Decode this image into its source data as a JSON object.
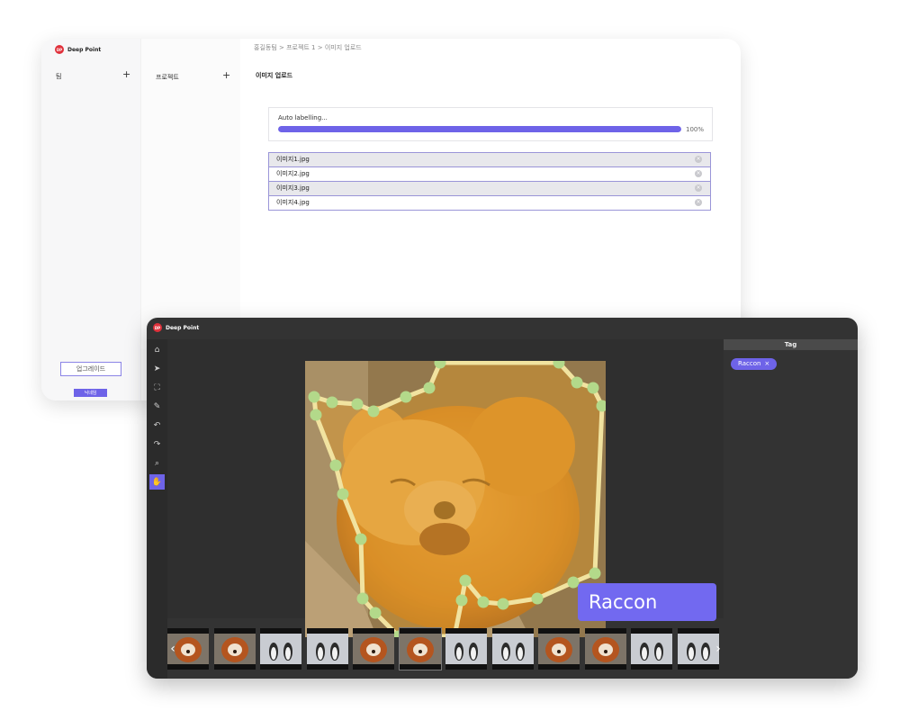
{
  "upload_window": {
    "brand": {
      "mark": "DP",
      "name": "Deep Point"
    },
    "team_column": {
      "label": "팀",
      "add_icon": "plus-icon"
    },
    "project_column": {
      "label": "프로젝트",
      "add_icon": "plus-icon"
    },
    "breadcrumb": "홍길동팀 > 프로젝트 1 > 이미지 업로드",
    "page_title": "이미지 업로드",
    "progress": {
      "label": "Auto labelling...",
      "percent_text": "100%",
      "value": 1.0
    },
    "files": [
      {
        "name": "이미지1.jpg"
      },
      {
        "name": "이미지2.jpg"
      },
      {
        "name": "이미지3.jpg"
      },
      {
        "name": "이미지4.jpg"
      }
    ],
    "upgrade_label": "업그레이드",
    "logout_label": "닉네임"
  },
  "tool_window": {
    "brand": {
      "mark": "DP",
      "name": "Deep Point"
    },
    "tools": [
      {
        "name": "home-icon",
        "glyph": "⌂"
      },
      {
        "name": "select-pointer-icon",
        "glyph": "➤"
      },
      {
        "name": "fit-screen-icon",
        "glyph": "⛶"
      },
      {
        "name": "pen-icon",
        "glyph": "✎"
      },
      {
        "name": "undo-icon",
        "glyph": "↶"
      },
      {
        "name": "redo-icon",
        "glyph": "↷"
      },
      {
        "name": "zoom-icon",
        "glyph": "⌕"
      },
      {
        "name": "hand-icon",
        "glyph": "✋"
      }
    ],
    "active_tool": 7,
    "tag_panel": {
      "title": "Tag",
      "tags": [
        {
          "label": "Raccon"
        }
      ]
    },
    "annotation_label": "Raccon",
    "filmstrip": {
      "thumbnails": [
        "red-panda",
        "red-panda",
        "penguins",
        "penguins",
        "red-panda",
        "red-panda",
        "penguins",
        "penguins",
        "red-panda",
        "red-panda",
        "penguins",
        "penguins"
      ],
      "active_index": 5,
      "prev_icon": "chevron-left-icon",
      "next_icon": "chevron-right-icon"
    },
    "colors": {
      "accent": "#6e63e8",
      "mask": "#e09a2a",
      "polygon_stroke": "#f1e3a0",
      "polygon_vertex": "#b3d98a"
    }
  }
}
